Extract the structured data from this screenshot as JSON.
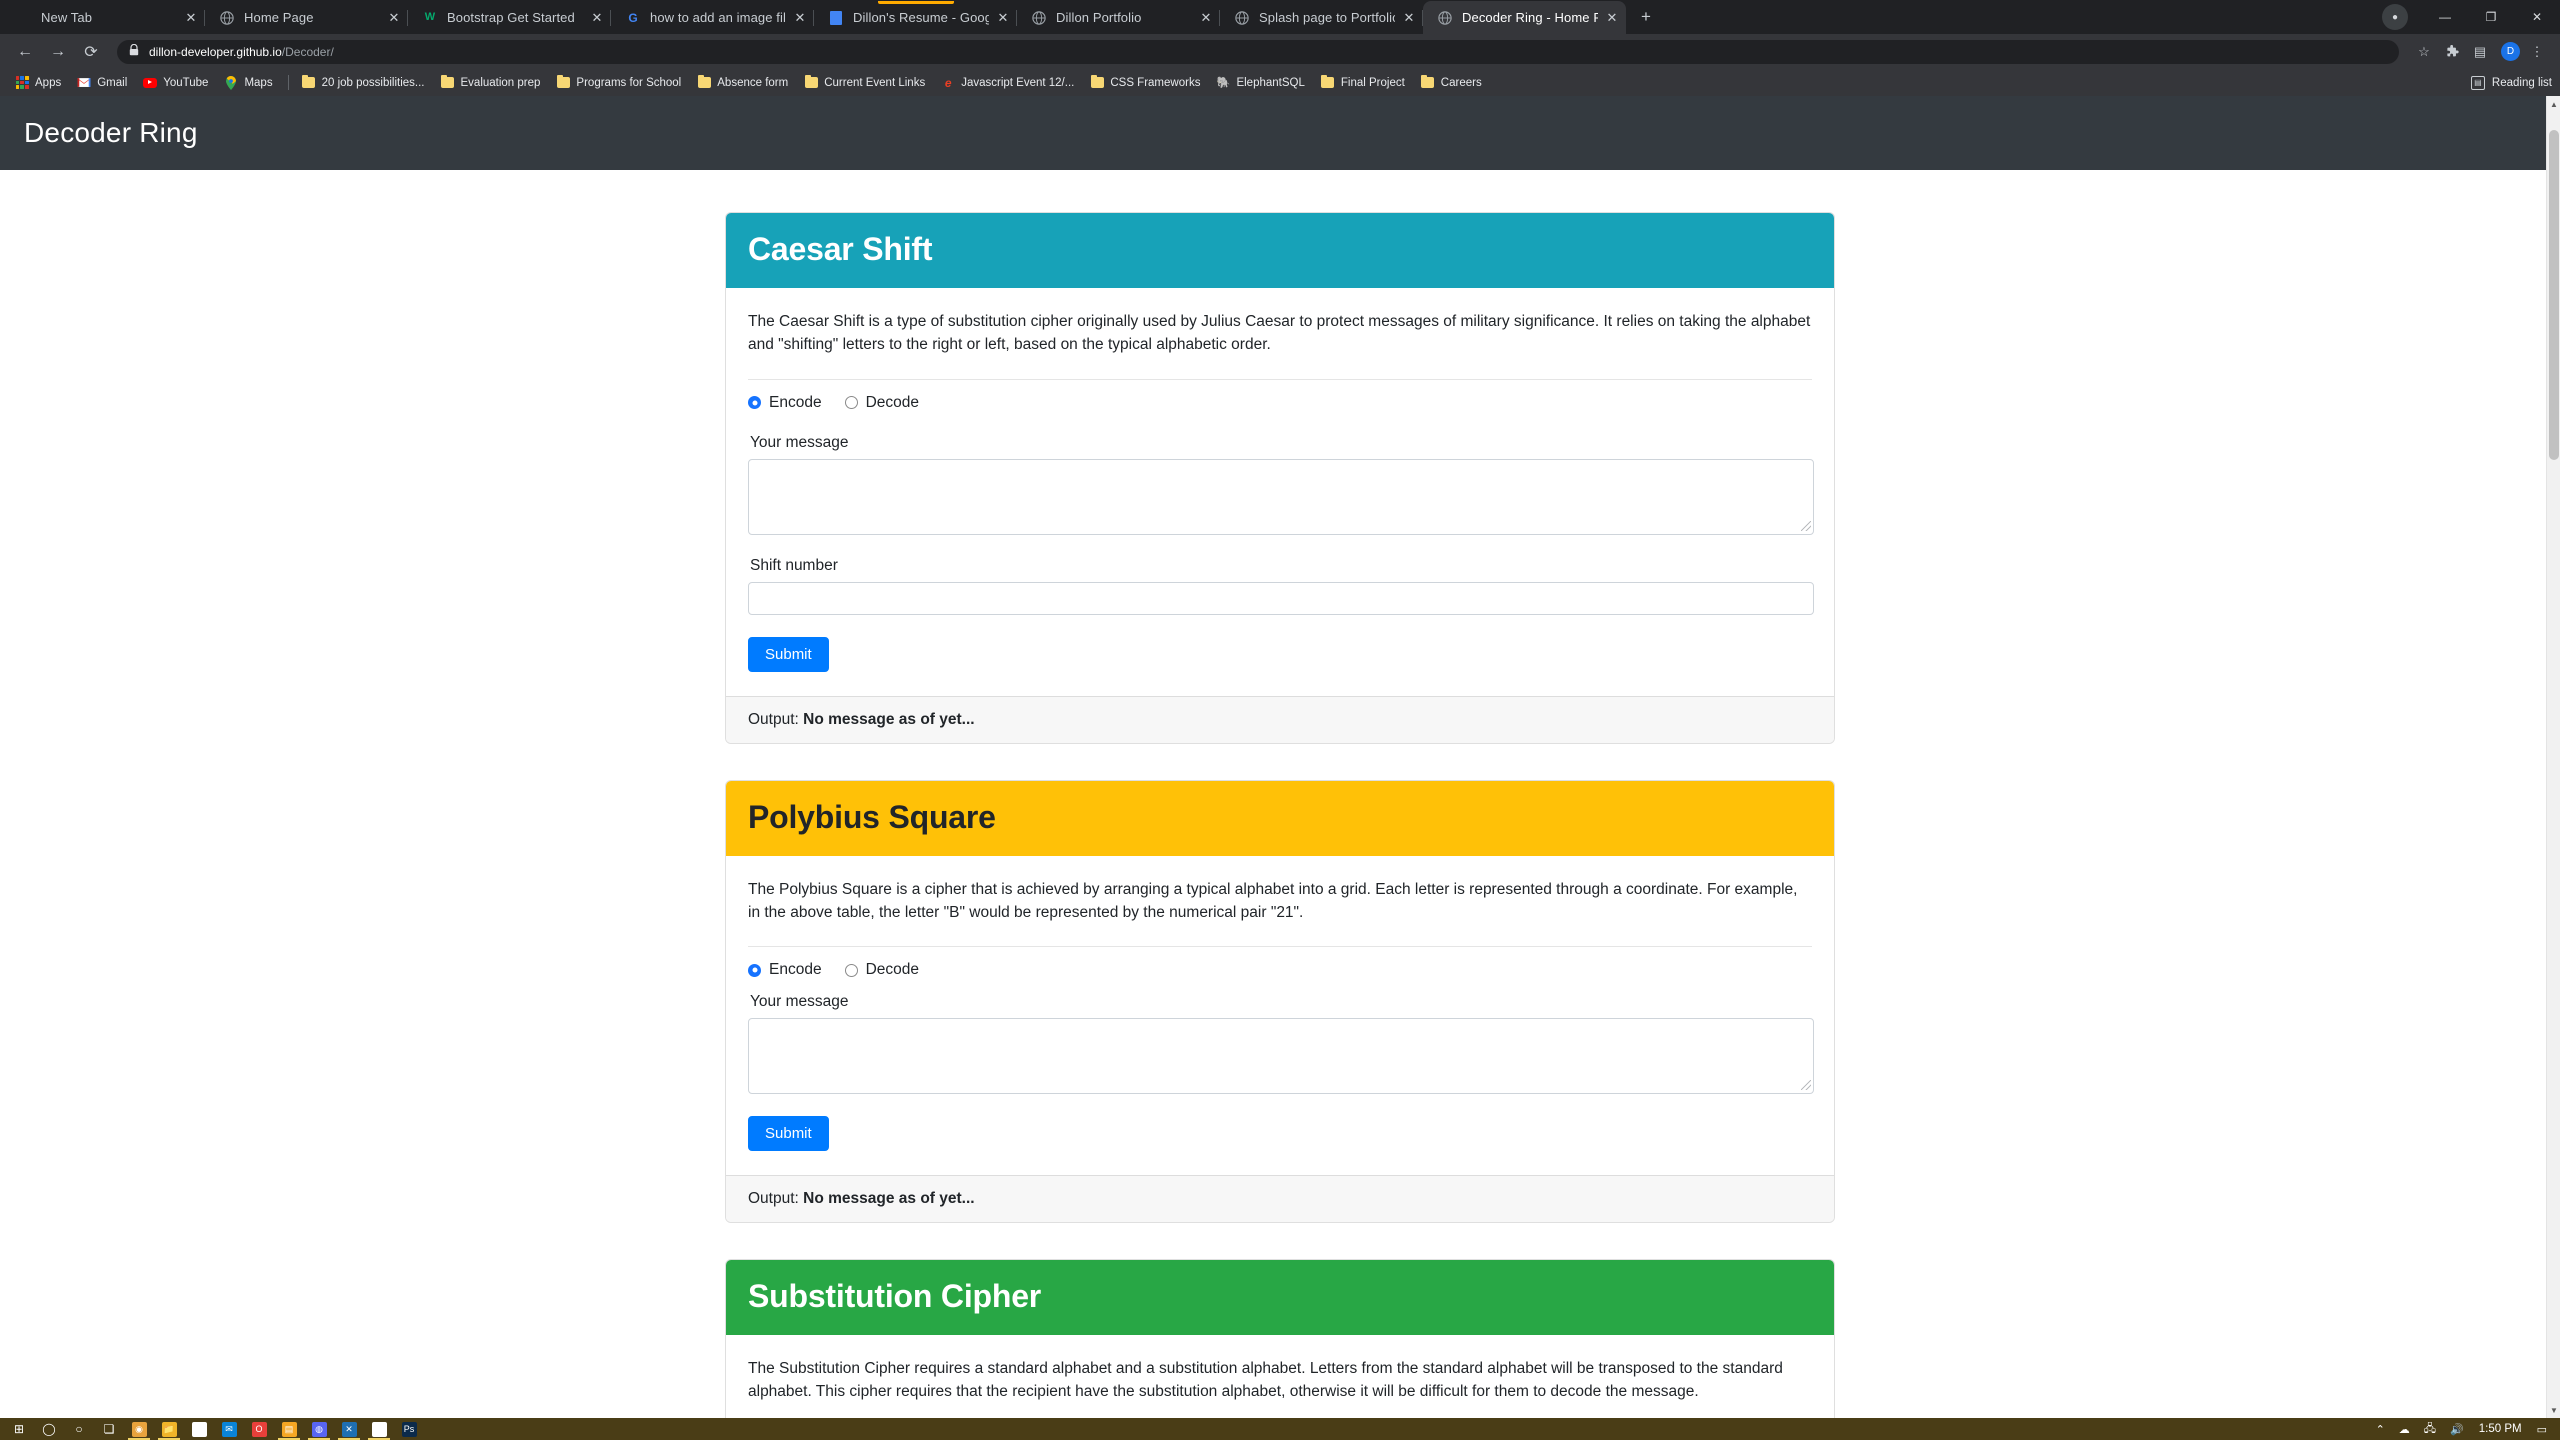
{
  "browser": {
    "tabs": [
      {
        "title": "New Tab",
        "favicon": "none",
        "active": false,
        "close": "✕"
      },
      {
        "title": "Home Page",
        "favicon": "globe-icon",
        "active": false,
        "close": "✕"
      },
      {
        "title": "Bootstrap Get Started",
        "favicon": "w3schools-icon",
        "active": false,
        "close": "✕"
      },
      {
        "title": "how to add an image file to vscod",
        "favicon": "google-icon",
        "active": false,
        "close": "✕"
      },
      {
        "title": "Dillon's Resume - Google Docs",
        "favicon": "google-docs-icon",
        "active": false,
        "close": "✕",
        "highlighted": true
      },
      {
        "title": "Dillon Portfolio",
        "favicon": "globe-icon",
        "active": false,
        "close": "✕"
      },
      {
        "title": "Splash page to Portfolio",
        "favicon": "globe-icon",
        "active": false,
        "close": "✕"
      },
      {
        "title": "Decoder Ring - Home Page",
        "favicon": "globe-icon",
        "active": true,
        "close": "✕"
      }
    ],
    "new_tab_label": "+",
    "window_controls": {
      "minimize": "—",
      "maximize": "❐",
      "close": "✕",
      "profile": "●"
    },
    "toolbar": {
      "back": "←",
      "forward": "→",
      "reload": "⟳",
      "lock_icon": "🔒",
      "url_host": "dillon-developer.github.io",
      "url_path": "/Decoder/",
      "star": "☆",
      "extensions": "🧩",
      "media": "▤",
      "avatar_letter": "D"
    },
    "bookmarks": [
      {
        "label": "Apps",
        "icon": "apps-grid-icon"
      },
      {
        "label": "Gmail",
        "icon": "gmail-icon"
      },
      {
        "label": "YouTube",
        "icon": "youtube-icon"
      },
      {
        "label": "Maps",
        "icon": "maps-pin-icon"
      },
      {
        "label": "20 job possibilities...",
        "icon": "folder-icon"
      },
      {
        "label": "Evaluation prep",
        "icon": "folder-icon"
      },
      {
        "label": "Programs for School",
        "icon": "folder-icon"
      },
      {
        "label": "Absence form",
        "icon": "folder-icon"
      },
      {
        "label": "Current Event Links",
        "icon": "folder-icon"
      },
      {
        "label": "Javascript Event 12/...",
        "icon": "edge-icon"
      },
      {
        "label": "CSS Frameworks",
        "icon": "folder-icon"
      },
      {
        "label": "ElephantSQL",
        "icon": "elephant-icon"
      },
      {
        "label": "Final Project",
        "icon": "folder-icon"
      },
      {
        "label": "Careers",
        "icon": "folder-icon"
      }
    ],
    "reading_list": {
      "label": "Reading list",
      "icon": "reading-list-icon"
    }
  },
  "page": {
    "navbar": {
      "brand": "Decoder Ring"
    },
    "colors": {
      "teal": "#17a2b8",
      "amber": "#ffc107",
      "green": "#28a745",
      "primary": "#007bff",
      "navbar": "#343a40"
    },
    "cards": [
      {
        "title": "Caesar Shift",
        "description": "The Caesar Shift is a type of substitution cipher originally used by Julius Caesar to protect messages of military significance. It relies on taking the alphabet and \"shifting\" letters to the right or left, based on the typical alphabetic order.",
        "radios": [
          {
            "label": "Encode",
            "checked": true
          },
          {
            "label": "Decode",
            "checked": false
          }
        ],
        "message_label": "Your message",
        "message_value": "",
        "message_placeholder": "",
        "shift_label": "Shift number",
        "shift_value": "",
        "shift_placeholder": "",
        "submit_label": "Submit",
        "output_label": "Output:",
        "output_value": "No message as of yet..."
      },
      {
        "title": "Polybius Square",
        "description": "The Polybius Square is a cipher that is achieved by arranging a typical alphabet into a grid. Each letter is represented through a coordinate. For example, in the above table, the letter \"B\" would be represented by the numerical pair \"21\".",
        "radios": [
          {
            "label": "Encode",
            "checked": true
          },
          {
            "label": "Decode",
            "checked": false
          }
        ],
        "message_label": "Your message",
        "message_value": "",
        "message_placeholder": "",
        "submit_label": "Submit",
        "output_label": "Output:",
        "output_value": "No message as of yet..."
      },
      {
        "title": "Substitution Cipher",
        "description": "The Substitution Cipher requires a standard alphabet and a substitution alphabet. Letters from the standard alphabet will be transposed to the standard alphabet. This cipher requires that the recipient have the substitution alphabet, otherwise it will be difficult for them to decode the message."
      }
    ]
  },
  "taskbar": {
    "start": "start-icon",
    "items": [
      {
        "name": "start-button",
        "glyph": "⊞",
        "color": "",
        "open": false
      },
      {
        "name": "search-button",
        "glyph": "◯",
        "color": "",
        "open": false
      },
      {
        "name": "cortana-button",
        "glyph": "○",
        "color": "",
        "open": false
      },
      {
        "name": "task-view-button",
        "glyph": "❏",
        "color": "",
        "open": false
      },
      {
        "name": "chrome-taskbar-icon",
        "glyph": "◉",
        "color": "#e8a33d",
        "open": true
      },
      {
        "name": "file-explorer-taskbar-icon",
        "glyph": "📁",
        "color": "#f0b429",
        "open": true
      },
      {
        "name": "microsoft-store-taskbar-icon",
        "glyph": "🛍",
        "color": "#ffffff",
        "open": false
      },
      {
        "name": "mail-taskbar-icon",
        "glyph": "✉",
        "color": "#0a84d8",
        "open": false
      },
      {
        "name": "opera-taskbar-icon",
        "glyph": "O",
        "color": "#e8403a",
        "open": false
      },
      {
        "name": "sticky-notes-taskbar-icon",
        "glyph": "▤",
        "color": "#f5a623",
        "open": true
      },
      {
        "name": "discord-taskbar-icon",
        "glyph": "◍",
        "color": "#5865f2",
        "open": true
      },
      {
        "name": "vscode-taskbar-icon",
        "glyph": "✕",
        "color": "#1f6fb2",
        "open": true
      },
      {
        "name": "slack-taskbar-icon",
        "glyph": "✳",
        "color": "#ffffff",
        "open": true
      },
      {
        "name": "photoshop-taskbar-icon",
        "glyph": "Ps",
        "color": "#0b2a4a",
        "open": false
      }
    ],
    "tray": {
      "overflow": "⌃",
      "cloud": "☁",
      "network": "🖧",
      "volume": "🔊",
      "clock": "1:50 PM",
      "notifications": "▭"
    }
  }
}
